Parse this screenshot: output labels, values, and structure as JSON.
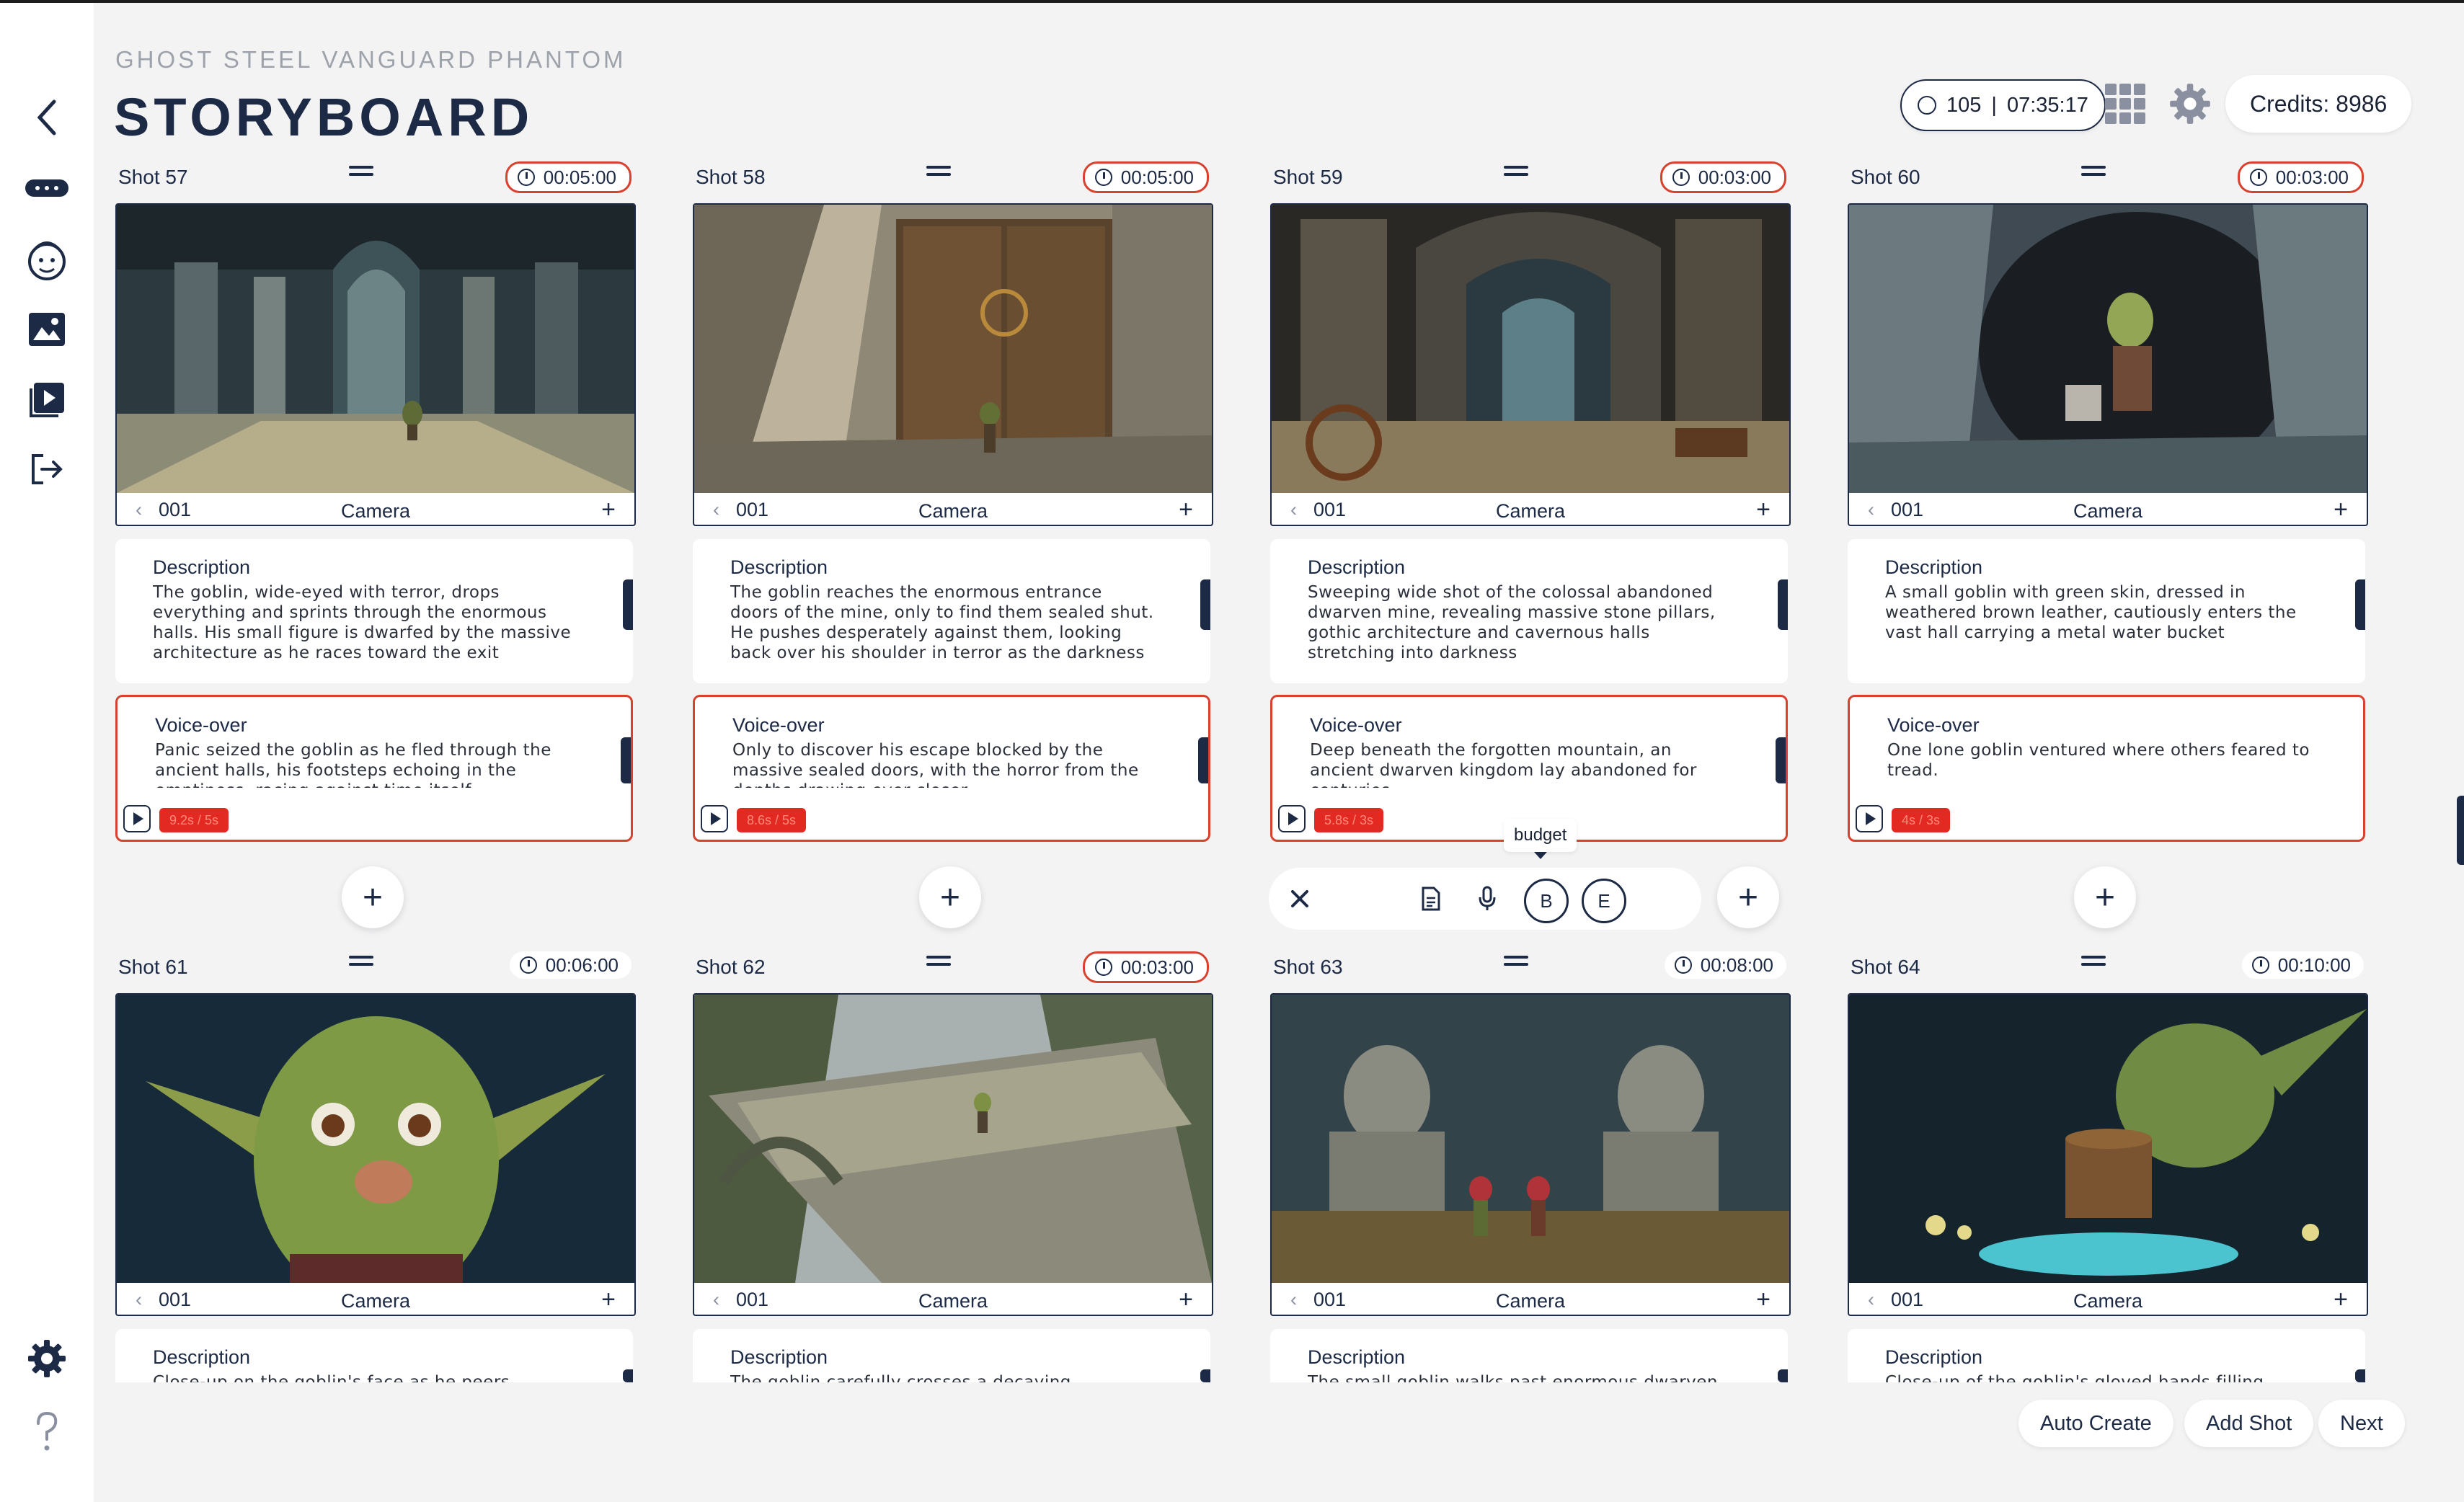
{
  "app": {
    "project_name": "GHOST STEEL VANGUARD PHANTOM",
    "page_title": "STORYBOARD",
    "shot_count": "105",
    "stats_divider": "|",
    "total_time": "07:35:17",
    "credits": "Credits: 8986"
  },
  "sidebar": {
    "items": [
      {
        "name": "back-icon"
      },
      {
        "name": "gamepad-icon"
      },
      {
        "name": "character-icon"
      },
      {
        "name": "image-gallery-icon"
      },
      {
        "name": "video-library-icon"
      },
      {
        "name": "logout-icon"
      },
      {
        "name": "settings-icon"
      },
      {
        "name": "help-icon"
      }
    ]
  },
  "shots": [
    {
      "name": "Shot 57",
      "duration": "00:05:00",
      "duration_highlight": true,
      "version": "001",
      "camera_label": "Camera",
      "description_label": "Description",
      "description": "The goblin, wide-eyed with terror, drops everything and sprints through the enormous halls. His small figure is dwarfed by the massive architecture as he races toward the exit",
      "voiceover_label": "Voice-over",
      "voiceover": "Panic seized the goblin as he fled through the ancient halls, his footsteps echoing in the emptiness, racing against time itself.",
      "voiceover_tag": "9.2s / 5s"
    },
    {
      "name": "Shot 58",
      "duration": "00:05:00",
      "duration_highlight": true,
      "version": "001",
      "camera_label": "Camera",
      "description_label": "Description",
      "description": "The goblin reaches the enormous entrance doors of the mine, only to find them sealed shut. He pushes desperately against them, looking back over his shoulder in terror as the darkness",
      "voiceover_label": "Voice-over",
      "voiceover": "Only to discover his escape blocked by the massive sealed doors, with the horror from the depths drawing ever closer.",
      "voiceover_tag": "8.6s / 5s"
    },
    {
      "name": "Shot 59",
      "duration": "00:03:00",
      "duration_highlight": true,
      "version": "001",
      "camera_label": "Camera",
      "description_label": "Description",
      "description": "Sweeping wide shot of the colossal abandoned dwarven mine, revealing massive stone pillars, gothic architecture and cavernous halls stretching into darkness",
      "voiceover_label": "Voice-over",
      "voiceover": "Deep beneath the forgotten mountain, an ancient dwarven kingdom lay abandoned for centuries.",
      "voiceover_tag": "5.8s / 3s"
    },
    {
      "name": "Shot 60",
      "duration": "00:03:00",
      "duration_highlight": true,
      "version": "001",
      "camera_label": "Camera",
      "description_label": "Description",
      "description": "A small goblin with green skin, dressed in weathered brown leather, cautiously enters the vast hall carrying a metal water bucket",
      "voiceover_label": "Voice-over",
      "voiceover": "One lone goblin ventured where others feared to tread.",
      "voiceover_tag": "4s / 3s"
    },
    {
      "name": "Shot 61",
      "duration": "00:06:00",
      "duration_highlight": false,
      "version": "001",
      "camera_label": "Camera",
      "description_label": "Description",
      "description": "Close-up on the goblin's face as he peers"
    },
    {
      "name": "Shot 62",
      "duration": "00:03:00",
      "duration_highlight": true,
      "version": "001",
      "camera_label": "Camera",
      "description_label": "Description",
      "description": "The goblin carefully crosses a decaying"
    },
    {
      "name": "Shot 63",
      "duration": "00:08:00",
      "duration_highlight": false,
      "version": "001",
      "camera_label": "Camera",
      "description_label": "Description",
      "description": "The small goblin walks past enormous dwarven"
    },
    {
      "name": "Shot 64",
      "duration": "00:10:00",
      "duration_highlight": false,
      "version": "001",
      "camera_label": "Camera",
      "description_label": "Description",
      "description": "Close-up of the goblin's gloved hands filling"
    }
  ],
  "toolbar": {
    "tooltip": "budget",
    "b_label": "B",
    "e_label": "E"
  },
  "actions": {
    "auto_create": "Auto Create",
    "add_shot": "Add Shot",
    "next": "Next"
  },
  "colors": {
    "accent": "#1c2a45",
    "warning": "#d9412f",
    "background": "#f3f3f4"
  }
}
